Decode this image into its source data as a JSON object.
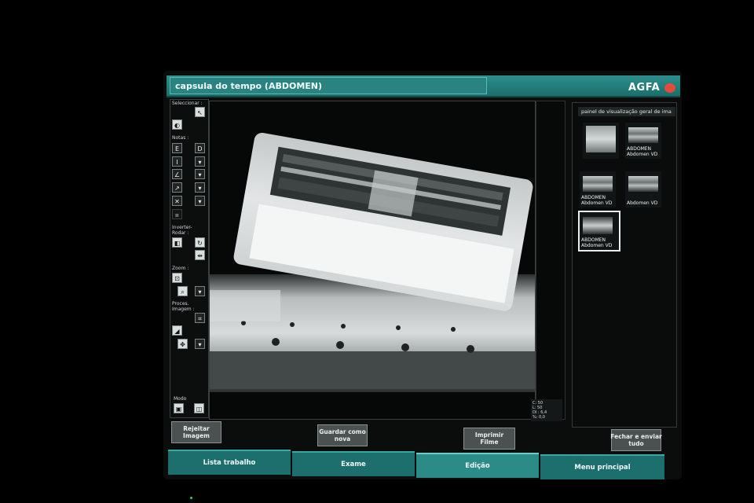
{
  "window": {
    "title": "capsula do tempo (ABDOMEN)",
    "brand": "AGFA"
  },
  "tools": {
    "seleccionar_label": "Seleccionar :",
    "notas_label": "Notas :",
    "inverter_label": "Inverter-\nRodar :",
    "zoom_label": "Zoom :",
    "proc_label": "Proces.\nImagem :",
    "modo_label": "Modo"
  },
  "overview": {
    "header": "painel de visualização geral de ima",
    "thumbs": [
      {
        "line1": "",
        "line2": ""
      },
      {
        "line1": "ABDOMEN",
        "line2": "Abdomen VD"
      },
      {
        "line1": "ABDOMEN",
        "line2": "Abdomen VD"
      },
      {
        "line1": "",
        "line2": "Abdomen VD"
      },
      {
        "line1": "ABDOMEN",
        "line2": "Abdomen VD"
      }
    ]
  },
  "window_level": {
    "c": "C: 50",
    "l": "L: 50",
    "di": "DI : 6,4",
    "zoom": "%: 0,0"
  },
  "actions": {
    "reject": "Rejeitar\nImagem",
    "save_new": "Guardar como\nnova",
    "print": "Imprimir Filme",
    "close_send": "Fechar e enviar\ntudo"
  },
  "tabs": [
    "Lista trabalho",
    "Exame",
    "Edição",
    "Menu principal"
  ],
  "colors": {
    "accent": "#2b8b87",
    "titlebar": "#1b6e6b",
    "brand_logo": "#e34b3b"
  }
}
